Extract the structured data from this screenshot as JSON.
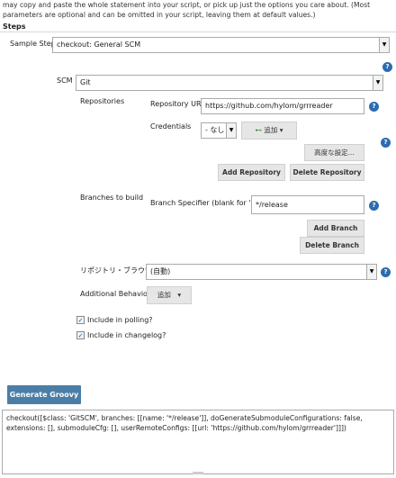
{
  "intro_text": "may copy and paste the whole statement into your script, or pick up just the options you care about. (Most parameters are optional and can be omitted in your script, leaving them at default values.)",
  "steps_heading": "Steps",
  "sample_step": {
    "label": "Sample Step",
    "value": "checkout: General SCM"
  },
  "scm": {
    "label": "SCM",
    "value": "Git"
  },
  "repositories": {
    "label": "Repositories",
    "url_label": "Repository URL",
    "url_value": "https://github.com/hylom/grrreader",
    "credentials_label": "Credentials",
    "credentials_value": "- なし -",
    "add_label": "追加",
    "advanced_label": "高度な設定...",
    "add_repo_label": "Add Repository",
    "delete_repo_label": "Delete Repository"
  },
  "branches": {
    "label": "Branches to build",
    "specifier_label": "Branch Specifier (blank for 'any')",
    "specifier_value": "*/release",
    "add_branch_label": "Add Branch",
    "delete_branch_label": "Delete Branch"
  },
  "browser": {
    "label": "リポジトリ・ブラウザ",
    "value": "(自動)"
  },
  "behaviours": {
    "label": "Additional Behaviours",
    "add_label": "追加"
  },
  "checkboxes": [
    {
      "label": "Include in polling?",
      "checked": true
    },
    {
      "label": "Include in changelog?",
      "checked": true
    }
  ],
  "generate_label": "Generate Groovy",
  "output_text": "checkout([$class: 'GitSCM', branches: [[name: '*/release']], doGenerateSubmoduleConfigurations: false, extensions: [], submoduleCfg: [], userRemoteConfigs: [[url: 'https://github.com/hylom/grrreader']]])",
  "icons": {
    "help": "help-icon",
    "dropdown": "dropdown-arrow-icon",
    "add": "key-add-icon",
    "check": "checkbox-checked-icon"
  },
  "colors": {
    "help": "#2b6cb0",
    "generate_button": "#4a7ea6"
  }
}
